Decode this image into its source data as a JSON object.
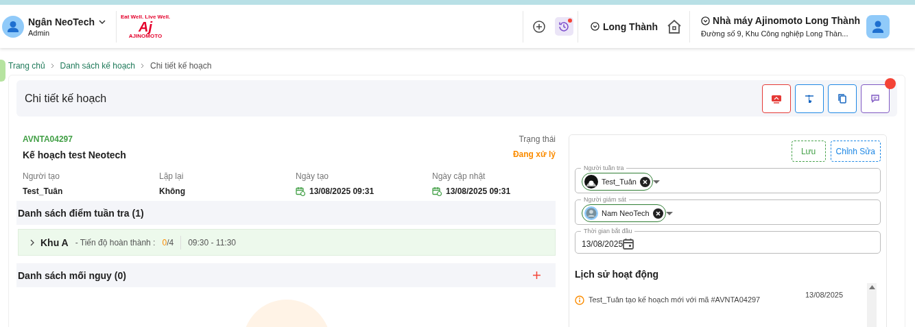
{
  "header": {
    "user": {
      "name": "Ngân NeoTech",
      "role": "Admin"
    },
    "logo": {
      "tagline": "Eat Well. Live Well.",
      "mark": "Aj",
      "wordmark": "AJINOMOTO"
    },
    "history_button": {
      "has_notification": true
    },
    "area": "Long Thành",
    "factory": {
      "name": "Nhà máy Ajinomoto Long Thành",
      "address": "Đường số 9, Khu Công nghiệp Long Thàn..."
    }
  },
  "breadcrumb": [
    {
      "label": "Trang chủ",
      "current": false
    },
    {
      "label": "Danh sách kế hoạch",
      "current": false
    },
    {
      "label": "Chi tiết kế hoạch",
      "current": true
    }
  ],
  "page_title": "Chi tiết kế hoạch",
  "actions": [
    {
      "kind": "screen",
      "badge": false
    },
    {
      "kind": "touch",
      "badge": false
    },
    {
      "kind": "copy",
      "badge": false
    },
    {
      "kind": "comment",
      "badge": true
    }
  ],
  "plan": {
    "code": "AVNTA04297",
    "name": "Kế hoạch test Neotech",
    "status_label": "Trạng thái",
    "status": "Đang xử lý",
    "fields": [
      {
        "label": "Người tạo",
        "value": "Test_Tuân",
        "kind": "text"
      },
      {
        "label": "Lặp lại",
        "value": "Không",
        "kind": "text"
      },
      {
        "label": "Ngày tạo",
        "value": "13/08/2025 09:31",
        "kind": "date"
      },
      {
        "label": "Ngày cập nhật",
        "value": "13/08/2025 09:31",
        "kind": "date"
      }
    ]
  },
  "checkpoints": {
    "title": "Danh sách điểm tuần tra (1)",
    "items": [
      {
        "name": "Khu A",
        "progress_label": "- Tiến độ hoàn thành :",
        "done": "0",
        "total": "/4",
        "time": "09:30 - 11:30",
        "expanded": false
      }
    ]
  },
  "hazards": {
    "title": "Danh sách mối nguy (0)"
  },
  "form": {
    "buttons": [
      {
        "label": "Lưu",
        "kind": "save"
      },
      {
        "label": "Chỉnh Sửa",
        "kind": "edit"
      }
    ],
    "fields": [
      {
        "kind": "chips",
        "label": "Người tuần tra",
        "chips": [
          {
            "name": "Test_Tuân",
            "kind": "photo"
          }
        ]
      },
      {
        "kind": "chips",
        "label": "Người giám sát",
        "chips": [
          {
            "name": "Nam NeoTech",
            "kind": "default"
          }
        ]
      },
      {
        "kind": "date",
        "label": "Thời gian bắt đầu",
        "value": "13/08/2025"
      }
    ]
  },
  "history": {
    "title": "Lịch sử hoạt động",
    "entries": [
      {
        "text": "Test_Tuân tạo kế hoạch mới với mã #AVNTA04297",
        "date": "13/08/2025"
      }
    ]
  }
}
